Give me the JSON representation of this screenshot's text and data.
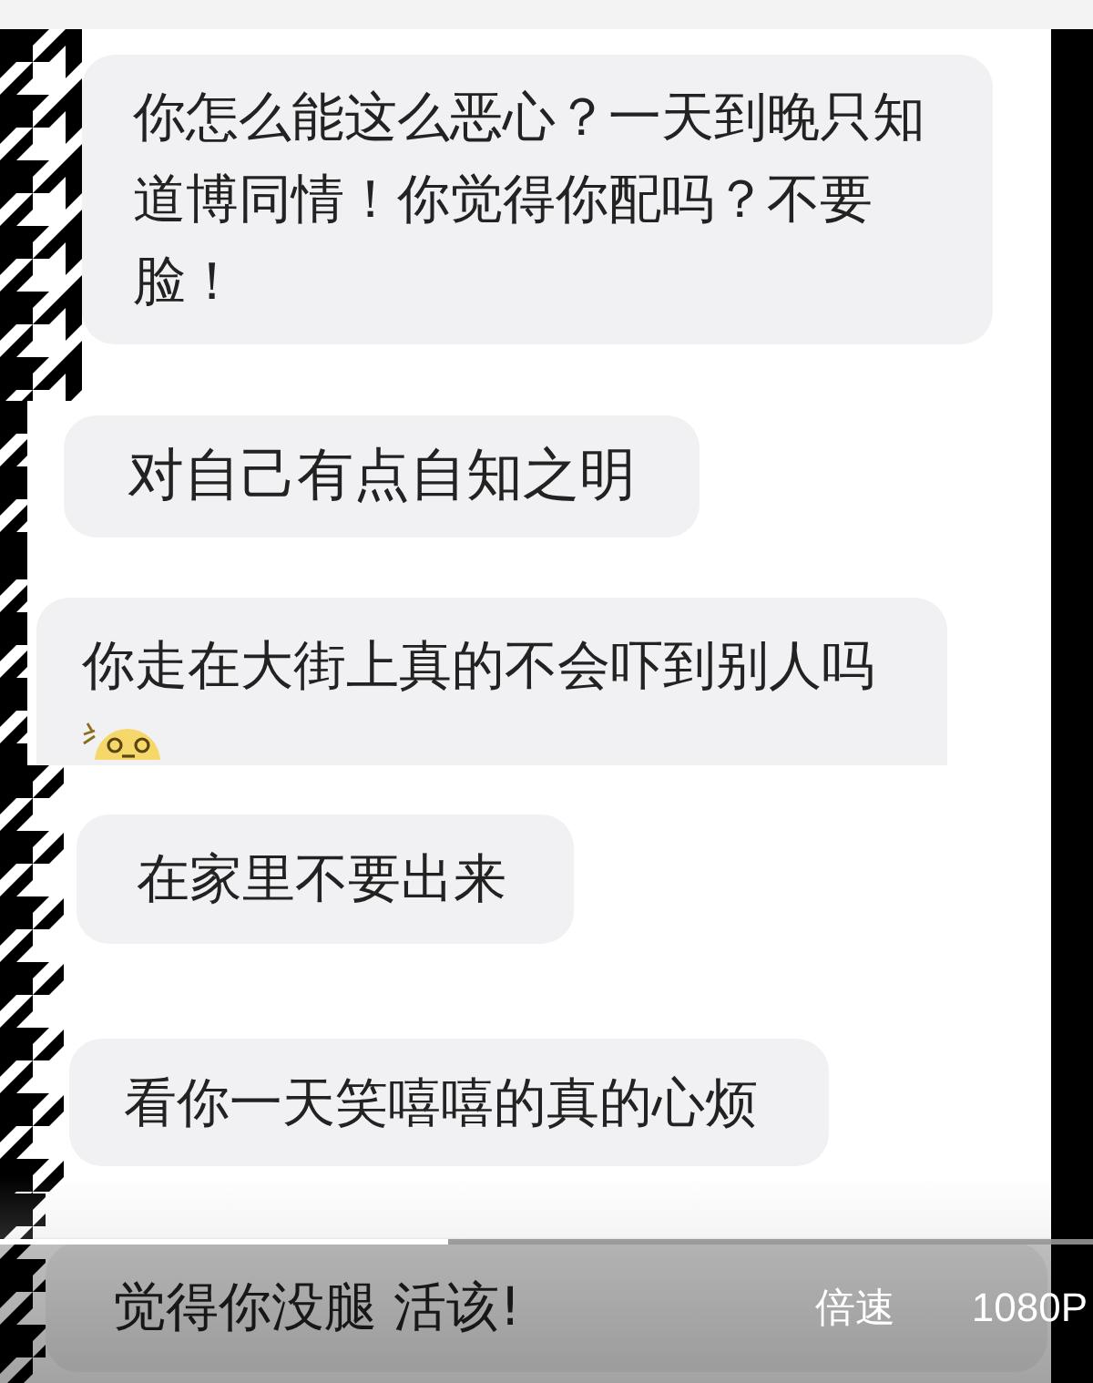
{
  "clips": [
    {
      "messages": [
        {
          "text": "你怎么能这么恶心？一天到晚只知道博同情！你觉得你配吗？不要脸！",
          "emoji": false
        }
      ]
    },
    {
      "messages": [
        {
          "text": "对自己有点自知之明",
          "emoji": false
        }
      ]
    },
    {
      "messages": [
        {
          "text": "你走在大街上真的不会吓到别人吗",
          "emoji": true
        }
      ]
    },
    {
      "messages": [
        {
          "text": "在家里不要出来",
          "emoji": false
        },
        {
          "text": "看你一天笑嘻嘻的真的心烦",
          "emoji": false
        }
      ]
    },
    {
      "messages": [
        {
          "text": "觉得你没腿 活该!",
          "emoji": false
        }
      ]
    }
  ],
  "player": {
    "progress": {
      "level": 0.41
    },
    "speed_button": "倍速",
    "quality_button": "1080P"
  }
}
